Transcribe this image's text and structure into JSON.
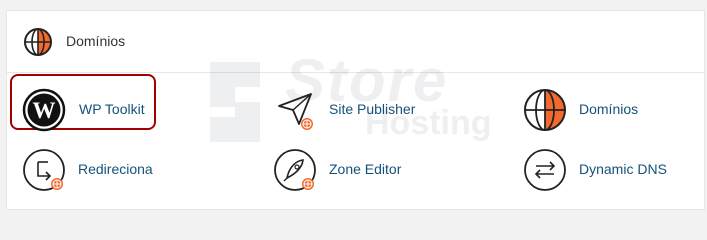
{
  "section": {
    "title": "Domínios"
  },
  "watermark": {
    "word1": "Store",
    "word2": "Hosting"
  },
  "items": [
    {
      "label": "WP Toolkit",
      "icon": "wordpress-icon"
    },
    {
      "label": "Site Publisher",
      "icon": "paper-plane-icon"
    },
    {
      "label": "Domínios",
      "icon": "globe-icon"
    },
    {
      "label": "Redireciona",
      "icon": "redirect-icon"
    },
    {
      "label": "Zone Editor",
      "icon": "rocket-icon"
    },
    {
      "label": "Dynamic DNS",
      "icon": "swap-arrows-icon"
    }
  ],
  "colors": {
    "accent": "#f26a2e",
    "link": "#15527a",
    "highlight_border": "#a40000"
  }
}
